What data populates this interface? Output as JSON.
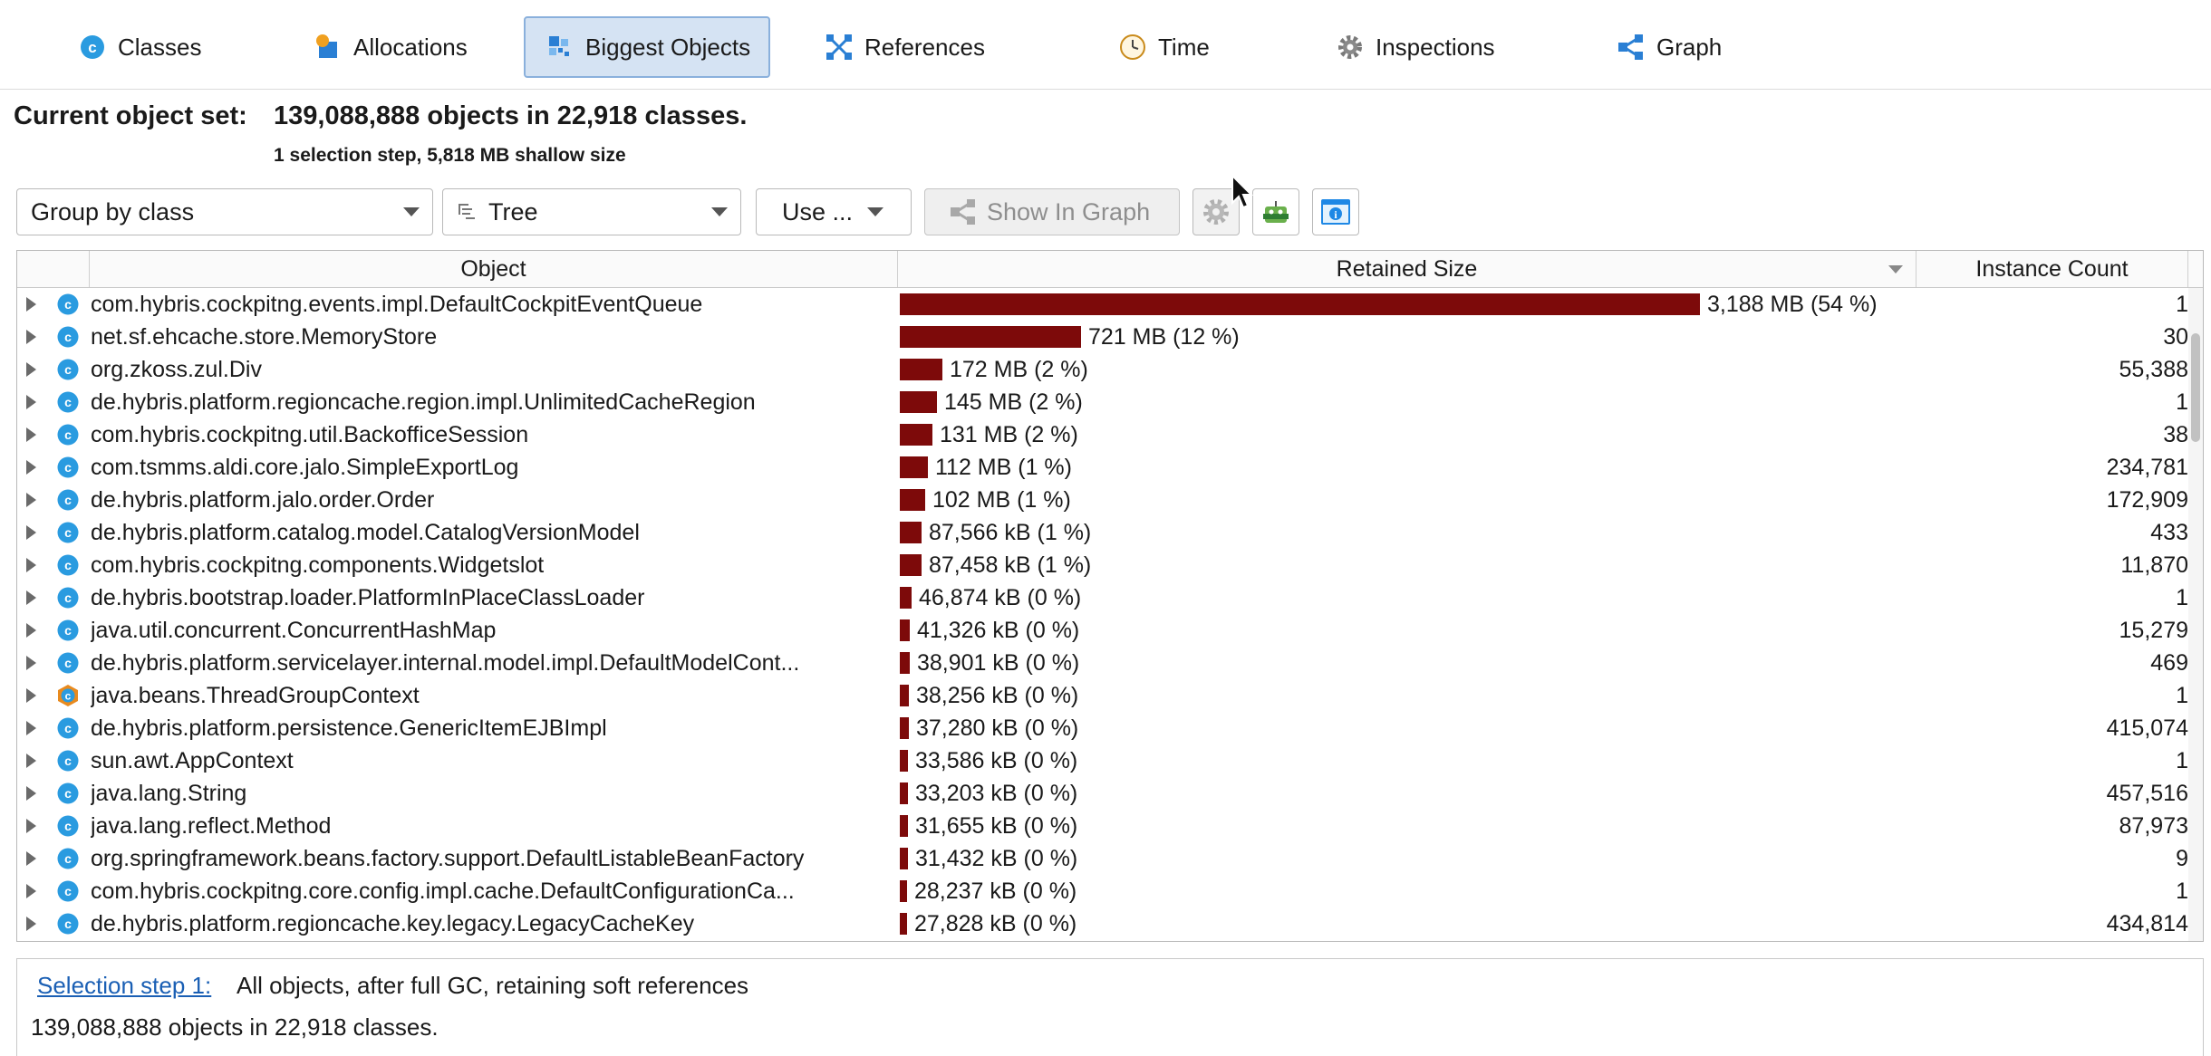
{
  "tabs": [
    {
      "label": "Classes",
      "icon": "class-c-icon",
      "active": false
    },
    {
      "label": "Allocations",
      "icon": "allocations-icon",
      "active": false
    },
    {
      "label": "Biggest Objects",
      "icon": "biggest-objects-icon",
      "active": true
    },
    {
      "label": "References",
      "icon": "references-icon",
      "active": false
    },
    {
      "label": "Time",
      "icon": "clock-icon",
      "active": false
    },
    {
      "label": "Inspections",
      "icon": "gear-icon",
      "active": false
    },
    {
      "label": "Graph",
      "icon": "graph-icon",
      "active": false
    }
  ],
  "header": {
    "label": "Current object set:",
    "value": "139,088,888 objects in 22,918 classes.",
    "detail": "1 selection step, 5,818 MB shallow size"
  },
  "toolbar": {
    "group_by": "Group by class",
    "view_mode": "Tree",
    "use_label": "Use ...",
    "show_in_graph": "Show In Graph"
  },
  "table": {
    "columns": [
      "Object",
      "Retained Size",
      "Instance Count"
    ],
    "rows": [
      {
        "name": "com.hybris.cockpitng.events.impl.DefaultCockpitEventQueue",
        "size": "3,188 MB (54 %)",
        "count": "1",
        "fraction": 0.54,
        "icon": "class-c-icon"
      },
      {
        "name": "net.sf.ehcache.store.MemoryStore",
        "size": "721 MB (12 %)",
        "count": "30",
        "fraction": 0.122,
        "icon": "class-c-icon"
      },
      {
        "name": "org.zkoss.zul.Div",
        "size": "172 MB (2 %)",
        "count": "55,388",
        "fraction": 0.029,
        "icon": "class-c-icon"
      },
      {
        "name": "de.hybris.platform.regioncache.region.impl.UnlimitedCacheRegion",
        "size": "145 MB (2 %)",
        "count": "1",
        "fraction": 0.025,
        "icon": "class-c-icon"
      },
      {
        "name": "com.hybris.cockpitng.util.BackofficeSession",
        "size": "131 MB (2 %)",
        "count": "38",
        "fraction": 0.022,
        "icon": "class-c-icon"
      },
      {
        "name": "com.tsmms.aldi.core.jalo.SimpleExportLog",
        "size": "112 MB (1 %)",
        "count": "234,781",
        "fraction": 0.019,
        "icon": "class-c-icon"
      },
      {
        "name": "de.hybris.platform.jalo.order.Order",
        "size": "102 MB (1 %)",
        "count": "172,909",
        "fraction": 0.017,
        "icon": "class-c-icon"
      },
      {
        "name": "de.hybris.platform.catalog.model.CatalogVersionModel",
        "size": "87,566 kB (1 %)",
        "count": "433",
        "fraction": 0.0145,
        "icon": "class-c-icon"
      },
      {
        "name": "com.hybris.cockpitng.components.Widgetslot",
        "size": "87,458 kB (1 %)",
        "count": "11,870",
        "fraction": 0.0145,
        "icon": "class-c-icon"
      },
      {
        "name": "de.hybris.bootstrap.loader.PlatformInPlaceClassLoader",
        "size": "46,874 kB (0 %)",
        "count": "1",
        "fraction": 0.0078,
        "icon": "class-c-icon"
      },
      {
        "name": "java.util.concurrent.ConcurrentHashMap",
        "size": "41,326 kB (0 %)",
        "count": "15,279",
        "fraction": 0.0069,
        "icon": "class-c-icon"
      },
      {
        "name": "de.hybris.platform.servicelayer.internal.model.impl.DefaultModelCont...",
        "size": "38,901 kB (0 %)",
        "count": "469",
        "fraction": 0.0065,
        "icon": "class-c-icon"
      },
      {
        "name": "java.beans.ThreadGroupContext",
        "size": "38,256 kB (0 %)",
        "count": "1",
        "fraction": 0.0064,
        "icon": "class-c-orange-icon"
      },
      {
        "name": "de.hybris.platform.persistence.GenericItemEJBImpl",
        "size": "37,280 kB (0 %)",
        "count": "415,074",
        "fraction": 0.0062,
        "icon": "class-c-icon"
      },
      {
        "name": "sun.awt.AppContext",
        "size": "33,586 kB (0 %)",
        "count": "1",
        "fraction": 0.0056,
        "icon": "class-c-icon"
      },
      {
        "name": "java.lang.String",
        "size": "33,203 kB (0 %)",
        "count": "457,516",
        "fraction": 0.0055,
        "icon": "class-c-icon"
      },
      {
        "name": "java.lang.reflect.Method",
        "size": "31,655 kB (0 %)",
        "count": "87,973",
        "fraction": 0.0053,
        "icon": "class-c-icon"
      },
      {
        "name": "org.springframework.beans.factory.support.DefaultListableBeanFactory",
        "size": "31,432 kB (0 %)",
        "count": "9",
        "fraction": 0.0052,
        "icon": "class-c-icon"
      },
      {
        "name": "com.hybris.cockpitng.core.config.impl.cache.DefaultConfigurationCa...",
        "size": "28,237 kB (0 %)",
        "count": "1",
        "fraction": 0.0047,
        "icon": "class-c-icon"
      },
      {
        "name": "de.hybris.platform.regioncache.key.legacy.LegacyCacheKey",
        "size": "27,828 kB (0 %)",
        "count": "434,814",
        "fraction": 0.0046,
        "icon": "class-c-icon"
      }
    ]
  },
  "selection": {
    "link": "Selection step 1:",
    "text": "All objects, after full GC, retaining soft references",
    "summary": "139,088,888 objects in 22,918 classes."
  },
  "colors": {
    "bar": "#7d0a0a",
    "class_icon": "#2a9be0",
    "class_icon_orange": "#e88a1e",
    "tab_active_bg": "#d5e3f3"
  }
}
